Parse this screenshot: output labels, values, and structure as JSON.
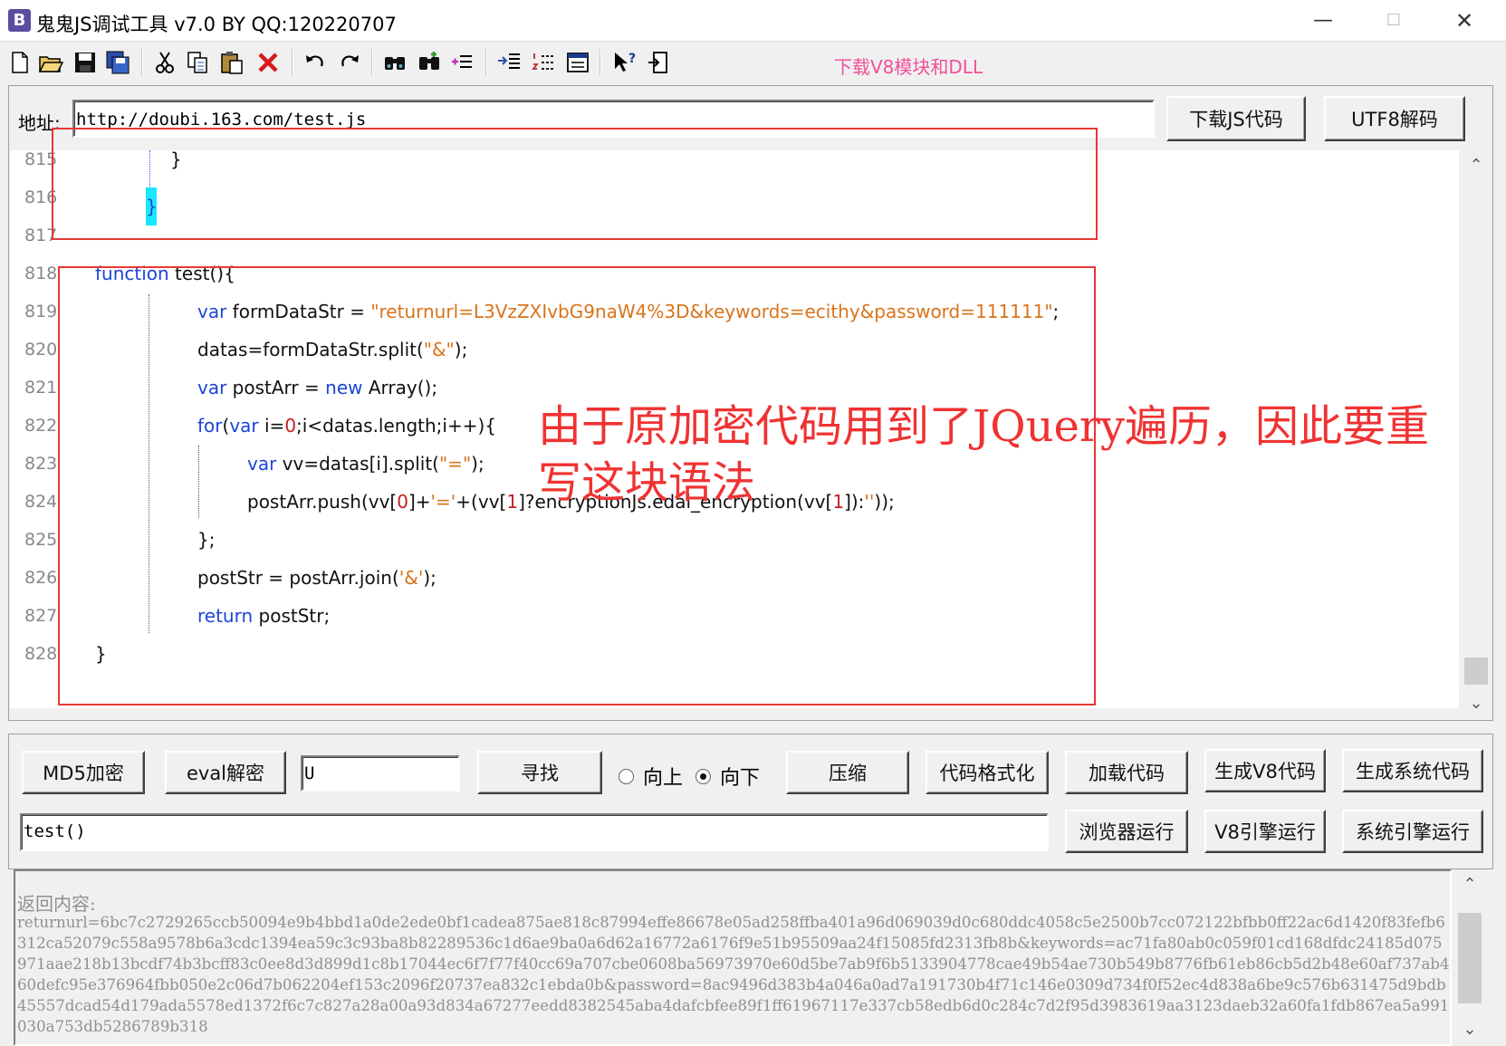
{
  "window": {
    "title": "鬼鬼JS调试工具 v7.0 BY QQ:120220707",
    "app_icon_letter": "B",
    "minimize": "—",
    "maximize": "☐",
    "close": "✕"
  },
  "toolbar": {
    "download_link": "下载V8模块和DLL",
    "icons": [
      "new-file-icon",
      "open-folder-icon",
      "save-icon",
      "save-all-icon",
      "cut-icon",
      "copy-icon",
      "paste-icon",
      "delete-icon",
      "undo-icon",
      "redo-icon",
      "find-icon",
      "find-next-icon",
      "add-list-icon",
      "indent-list-icon",
      "numbered-list-icon",
      "window-icon",
      "help-cursor-icon",
      "exit-icon"
    ]
  },
  "address": {
    "label": "地址:",
    "value": "http://doubi.163.com/test.js",
    "download_button": "下载JS代码",
    "utf8_button": "UTF8解码"
  },
  "editor": {
    "lines": [
      {
        "num": "815",
        "text": "}"
      },
      {
        "num": "816",
        "text": "}"
      },
      {
        "num": "817",
        "text": ""
      },
      {
        "num": "818",
        "kw": "function",
        "text": " test(){"
      },
      {
        "num": "819",
        "kw": "var",
        "text": " formDataStr = ",
        "str": "\"returnurl=L3VzZXIvbG9naW4%3D&keywords=ecithy&password=111111\"",
        "end": ";"
      },
      {
        "num": "820",
        "text": "datas=formDataStr.split(",
        "str": "\"&\"",
        "end": ");"
      },
      {
        "num": "821",
        "kw": "var",
        "text": " postArr = ",
        "kw2": "new",
        "end": " Array();"
      },
      {
        "num": "822",
        "kw": "for",
        "text": "(",
        "kw2": "var",
        "mid": " i=",
        "n1": "0",
        "end": ";i<datas.length;i++){"
      },
      {
        "num": "823",
        "kw": "var",
        "text": " vv=datas[i].split(",
        "str": "\"=\"",
        "end": ");"
      },
      {
        "num": "824",
        "text": "postArr.push(vv[",
        "n1": "0",
        "mid": "]+",
        "str": "'='",
        "mid2": "+(vv[",
        "n2": "1",
        "mid3": "]?encryptionJs.edai_encryption(vv[",
        "n3": "1",
        "mid4": "]):",
        "str2": "''",
        "end": "));"
      },
      {
        "num": "825",
        "text": "};"
      },
      {
        "num": "826",
        "text": "postStr = postArr.join(",
        "str": "'&'",
        "end": ");"
      },
      {
        "num": "827",
        "kw": "return",
        "text": " postStr;"
      },
      {
        "num": "828",
        "text": "}"
      }
    ],
    "annotation": "由于原加密代码用到了JQuery遍历，因此要重写这块语法"
  },
  "controls": {
    "md5_button": "MD5加密",
    "eval_button": "eval解密",
    "search_value": "U",
    "find_button": "寻找",
    "radio_up": "向上",
    "radio_down": "向下",
    "radio_selected": "down",
    "compress_button": "压缩",
    "format_button": "代码格式化",
    "load_button": "加载代码",
    "gen_v8_button": "生成V8代码",
    "gen_sys_button": "生成系统代码",
    "command_value": "test()",
    "browser_run_button": "浏览器运行",
    "v8_run_button": "V8引擎运行",
    "sys_run_button": "系统引擎运行"
  },
  "output": {
    "label": "返回内容:",
    "text": "returnurl=6bc7c2729265ccb50094e9b4bbd1a0de2ede0bf1cadea875ae818c87994effe86678e05ad258ffba401a96d069039d0c680ddc4058c5e2500b7cc072122bfbb0ff22ac6d1420f83fefb6312ca52079c558a9578b6a3cdc1394ea59c3c93ba8b82289536c1d6ae9ba0a6d62a16772a6176f9e51b95509aa24f15085fd2313fb8b&keywords=ac71fa80ab0c059f01cd168dfdc24185d075971aae218b13bcdf74b3bcff83c0ee8d3d899d1c8b17044ec6f7f77f40cc69a707cbe0608ba56973970e60d5be7ab9f6b5133904778cae49b54ae730b549b8776fb61eb86cb5d2b48e60af737ab460defc95e376964fbb050e2c06d7b062204ef153c2096f20737ea832c1ebda0b&password=8ac9496d383b4a046a0ad7a191730b4f71c146e0309d734f0f52ec4d838a6be9c576b631475d9bdb45557dcad54d179ada5578ed1372f6c7c827a28a00a93d834a67277eedd8382545aba4dafcbfee89f1ff61967117e337cb58edb6d0c284c7d2f95d3983619aa3123daeb32a60fa1fdb867ea5a991030a753db5286789b318"
  }
}
